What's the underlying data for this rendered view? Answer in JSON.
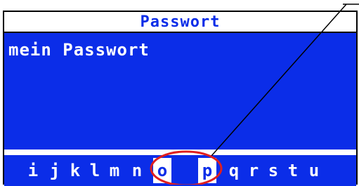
{
  "dialog": {
    "title": "Passwort",
    "value": "mein Passwort"
  },
  "char_selector": {
    "chars": [
      "i",
      "j",
      "k",
      "l",
      "m",
      "n",
      "o",
      "p",
      "q",
      "r",
      "s",
      "t",
      "u"
    ],
    "selected_chars": [
      "o",
      "p"
    ]
  },
  "colors": {
    "screen_blue": "#0b2de8",
    "highlight_circle": "#e01f1f",
    "background": "#ffffff",
    "text_on_blue": "#ffffff"
  }
}
